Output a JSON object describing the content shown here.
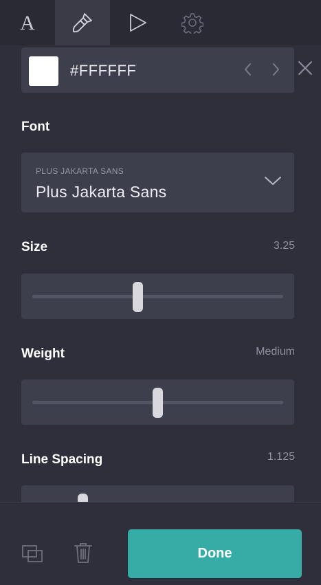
{
  "tabs": [
    {
      "name": "text",
      "icon": "letter-a-icon",
      "active": false
    },
    {
      "name": "style",
      "icon": "paintbrush-icon",
      "active": true
    },
    {
      "name": "animation",
      "icon": "play-icon",
      "active": false
    },
    {
      "name": "settings",
      "icon": "gear-icon",
      "active": false
    }
  ],
  "color": {
    "swatch": "#FFFFFF",
    "hex_value": "#FFFFFF"
  },
  "font": {
    "label": "Font",
    "preview_caption": "PLUS JAKARTA SANS",
    "selected": "Plus Jakarta Sans"
  },
  "size": {
    "label": "Size",
    "value": "3.25",
    "level": 0.42
  },
  "weight": {
    "label": "Weight",
    "value": "Medium",
    "level": 0.5
  },
  "line_spacing": {
    "label": "Line Spacing",
    "value": "1.125",
    "level": 0.2
  },
  "footer": {
    "done_label": "Done"
  },
  "colors": {
    "accent": "#35ADA6",
    "background": "#2F2F3B",
    "panel": "#3E3F4D"
  }
}
